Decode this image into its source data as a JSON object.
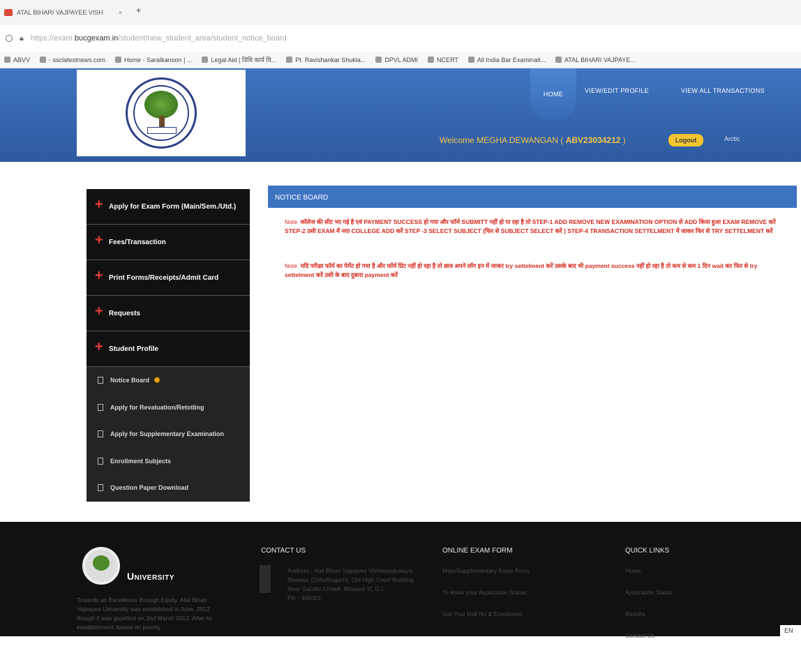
{
  "browser": {
    "tab_title": "ATAL BIHARI VAJPAYEE VISH",
    "url_prefix": "https://exam.",
    "url_domain": "bucgexam.in",
    "url_path": "/student/new_student_area/student_notice_board",
    "bookmarks": [
      "ABVV",
      "- ssclatestnews.com",
      "Home - Saralkanoon | ...",
      "Legal Aid | विधि कार्य वि...",
      "Pt. Ravishankar Shukla...",
      "DPVL ADMI",
      "NCERT",
      "All India Bar Examinati...",
      "ATAL BIHARI VAJPAYE..."
    ]
  },
  "nav": {
    "home": "HOME",
    "profile": "VIEW/EDIT PROFILE",
    "transactions": "VIEW ALL TRANSACTIONS"
  },
  "user": {
    "welcome_prefix": "Welcome MEGHA DEWANGAN ( ",
    "id": "ABV23034212",
    "welcome_suffix": " )",
    "logout": "Logout",
    "extra": "Arctic"
  },
  "menu": {
    "items": [
      "Apply for Exam Form (Main/Sem./Utd.)",
      "Fees/Transaction",
      "Print Forms/Receipts/Admit Card",
      "Requests",
      "Student Profile"
    ],
    "sub_items": [
      "Notice Board",
      "Apply for Revaluation/Retotling",
      "Apply for Supplementary Examination",
      "Enrollment Subjects",
      "Question Paper Download"
    ]
  },
  "notice": {
    "title": "NOTICE BOARD",
    "label": "Note",
    "note1": "कॉलेज की सीट भर गई है एवं PAYMENT SUCCESS हो गया और फॉर्म SUBMITT नहीं हो पा रहा है तो STEP-1 ADD REMOVE NEW EXAMINATION OPTION से ADD किया हुआ EXAM REMOVE करें STEP-2 उसी EXAM में नया COLLEGE ADD करें STEP -3 SELECT SUBJECT (फिर से SUBJECT SELECT करें ) STEP-4 TRANSACTION SETTELMENT में जाकर फिर से TRY SETTELMENT करें",
    "note2": "यदि परीक्षा फॉर्म का पेमेंट हो गया है और फॉर्म प्रिंट नहीं हो रहा है तो छात्र अपने लॉग इन में जाकर try settelment करें उसके बाद भी payment success नहीं हो रहा है तो कम से कम 1 दिन wait कर फिर से try settelment करें उसी के बाद दुबारा payment करें"
  },
  "footer": {
    "university": "University",
    "about": "Towards an Excellence through Equity. Atal Bihari Vajpayee University was established in June, 2012 though it was gazetted on 2nd March 2012. After its establishment, based on priority",
    "contact_title": "CONTACT US",
    "contact_lines": [
      "Address : Atal Bihari Vajpayee Vishwavidyalaya, Bilaspur (Chhattisgarh), Old High Court Building Near Gandhi Chowk, Bilaspur (C.G.)",
      "Pin - 495001"
    ],
    "exam_title": "ONLINE EXAM FORM",
    "exam_links": [
      "Main/Supplementary Exam Form",
      "To know your Application Status",
      "Get Your Roll No & Enrollment"
    ],
    "quick_title": "QUICK LINKS",
    "quick_links": [
      "Home",
      "Application Status",
      "Results",
      "Contact Us"
    ]
  },
  "lang": "EN"
}
